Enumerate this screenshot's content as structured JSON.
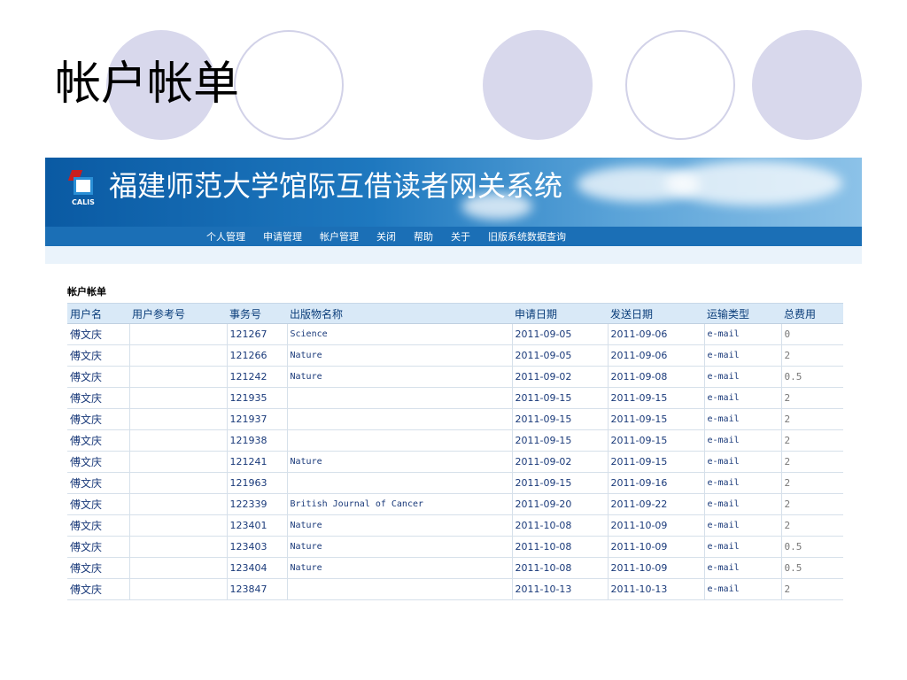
{
  "slide": {
    "title": "帐户帐单"
  },
  "header": {
    "system_title": "福建师范大学馆际互借读者网关系统",
    "logo_text": "CALIS"
  },
  "nav": {
    "items": [
      "个人管理",
      "申请管理",
      "帐户管理",
      "关闭",
      "帮助",
      "关于",
      "旧版系统数据查询"
    ]
  },
  "section": {
    "label": "帐户帐单"
  },
  "table": {
    "columns": [
      "用户名",
      "用户参考号",
      "事务号",
      "出版物名称",
      "申请日期",
      "发送日期",
      "运输类型",
      "总费用"
    ],
    "rows": [
      [
        "傅文庆",
        "",
        "121267",
        "Science",
        "2011-09-05",
        "2011-09-06",
        "e-mail",
        "0"
      ],
      [
        "傅文庆",
        "",
        "121266",
        "Nature",
        "2011-09-05",
        "2011-09-06",
        "e-mail",
        "2"
      ],
      [
        "傅文庆",
        "",
        "121242",
        "Nature",
        "2011-09-02",
        "2011-09-08",
        "e-mail",
        "0.5"
      ],
      [
        "傅文庆",
        "",
        "121935",
        "",
        "2011-09-15",
        "2011-09-15",
        "e-mail",
        "2"
      ],
      [
        "傅文庆",
        "",
        "121937",
        "",
        "2011-09-15",
        "2011-09-15",
        "e-mail",
        "2"
      ],
      [
        "傅文庆",
        "",
        "121938",
        "",
        "2011-09-15",
        "2011-09-15",
        "e-mail",
        "2"
      ],
      [
        "傅文庆",
        "",
        "121241",
        "Nature",
        "2011-09-02",
        "2011-09-15",
        "e-mail",
        "2"
      ],
      [
        "傅文庆",
        "",
        "121963",
        "",
        "2011-09-15",
        "2011-09-16",
        "e-mail",
        "2"
      ],
      [
        "傅文庆",
        "",
        "122339",
        "British Journal of Cancer",
        "2011-09-20",
        "2011-09-22",
        "e-mail",
        "2"
      ],
      [
        "傅文庆",
        "",
        "123401",
        "Nature",
        "2011-10-08",
        "2011-10-09",
        "e-mail",
        "2"
      ],
      [
        "傅文庆",
        "",
        "123403",
        "Nature",
        "2011-10-08",
        "2011-10-09",
        "e-mail",
        "0.5"
      ],
      [
        "傅文庆",
        "",
        "123404",
        "Nature",
        "2011-10-08",
        "2011-10-09",
        "e-mail",
        "0.5"
      ],
      [
        "傅文庆",
        "",
        "123847",
        "",
        "2011-10-13",
        "2011-10-13",
        "e-mail",
        "2"
      ]
    ]
  }
}
